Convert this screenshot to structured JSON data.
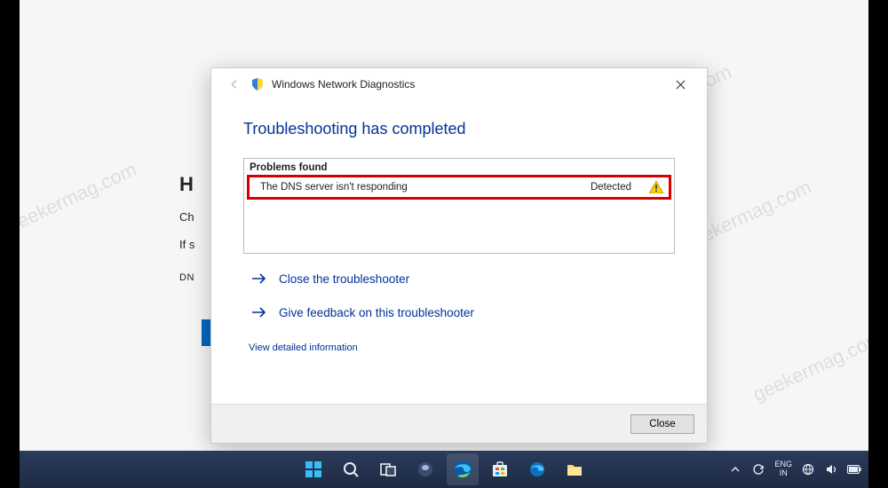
{
  "watermark_text": "geekermag.com",
  "bg_page": {
    "header_fragment": "H",
    "line1_fragment": "Ch",
    "line2_fragment": "If s",
    "dn_fragment": "DN"
  },
  "dialog": {
    "title": "Windows Network Diagnostics",
    "heading": "Troubleshooting has completed",
    "problems_label": "Problems found",
    "problem": {
      "text": "The DNS server isn't responding",
      "status": "Detected"
    },
    "action_close": "Close the troubleshooter",
    "action_feedback": "Give feedback on this troubleshooter",
    "view_detailed": "View detailed information",
    "close_button": "Close"
  },
  "taskbar": {
    "lang_line1": "ENG",
    "lang_line2": "IN"
  }
}
